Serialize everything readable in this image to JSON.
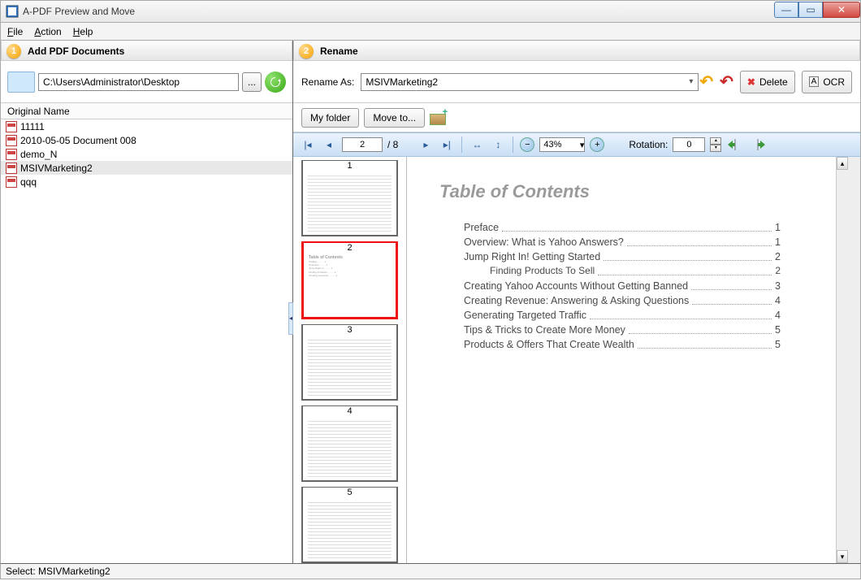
{
  "window": {
    "title": "A-PDF Preview and Move"
  },
  "menu": {
    "file": "File",
    "action": "Action",
    "help": "Help"
  },
  "left": {
    "header": "Add PDF Documents",
    "number": "1",
    "path": "C:\\Users\\Administrator\\Desktop",
    "browse": "...",
    "list_header": "Original Name",
    "files": [
      {
        "name": "11111",
        "selected": false
      },
      {
        "name": "2010-05-05 Document 008",
        "selected": false
      },
      {
        "name": "demo_N",
        "selected": false
      },
      {
        "name": "MSIVMarketing2",
        "selected": true
      },
      {
        "name": "qqq",
        "selected": false
      }
    ]
  },
  "right": {
    "header": "Rename",
    "number": "2",
    "rename_label": "Rename As:",
    "rename_value": "MSIVMarketing2",
    "delete": "Delete",
    "ocr": "OCR",
    "myfolder": "My folder",
    "moveto": "Move to..."
  },
  "viewer": {
    "current_page": "2",
    "total_pages": "/ 8",
    "zoom": "43%",
    "rotation_label": "Rotation:",
    "rotation_value": "0",
    "thumbs": [
      "1",
      "2",
      "3",
      "4",
      "5"
    ],
    "selected_thumb": 1
  },
  "page": {
    "title": "Table of Contents",
    "lines": [
      {
        "name": "Preface",
        "pg": "1",
        "sub": false
      },
      {
        "name": "Overview: What is Yahoo Answers?",
        "pg": "1",
        "sub": false
      },
      {
        "name": "Jump Right In! Getting Started",
        "pg": "2",
        "sub": false
      },
      {
        "name": "Finding Products To Sell",
        "pg": "2",
        "sub": true
      },
      {
        "name": "Creating Yahoo Accounts Without Getting Banned",
        "pg": "3",
        "sub": false
      },
      {
        "name": "Creating Revenue: Answering & Asking Questions",
        "pg": "4",
        "sub": false
      },
      {
        "name": "Generating Targeted Traffic",
        "pg": "4",
        "sub": false
      },
      {
        "name": "Tips & Tricks to Create More Money",
        "pg": "5",
        "sub": false
      },
      {
        "name": "Products & Offers That Create Wealth",
        "pg": "5",
        "sub": false
      }
    ]
  },
  "status": {
    "text": "Select: MSIVMarketing2"
  }
}
